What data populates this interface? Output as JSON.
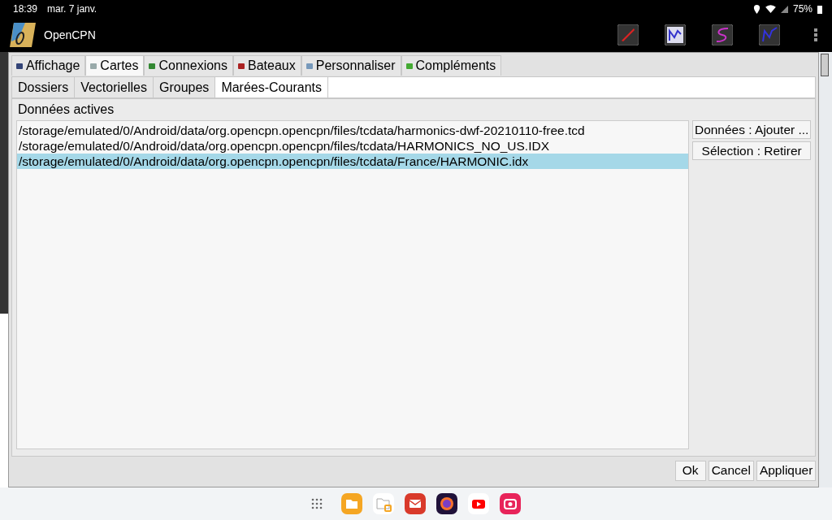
{
  "status_bar": {
    "time": "18:39",
    "date": "mar. 7 janv.",
    "battery": "75%"
  },
  "app_bar": {
    "title": "OpenCPN"
  },
  "tabs": [
    {
      "label": "Affichage",
      "selected": false,
      "color": "#334477"
    },
    {
      "label": "Cartes",
      "selected": true,
      "color": "#99aaaa"
    },
    {
      "label": "Connexions",
      "selected": false,
      "color": "#338833"
    },
    {
      "label": "Bateaux",
      "selected": false,
      "color": "#aa2222"
    },
    {
      "label": "Personnaliser",
      "selected": false,
      "color": "#7799bb"
    },
    {
      "label": "Compléments",
      "selected": false,
      "color": "#44aa33"
    }
  ],
  "subtabs": [
    {
      "label": "Dossiers",
      "selected": false
    },
    {
      "label": "Vectorielles",
      "selected": false
    },
    {
      "label": "Groupes",
      "selected": false
    },
    {
      "label": "Marées-Courants",
      "selected": true
    }
  ],
  "section_label": "Données actives",
  "files": [
    {
      "path": "/storage/emulated/0/Android/data/org.opencpn.opencpn/files/tcdata/harmonics-dwf-20210110-free.tcd",
      "selected": false
    },
    {
      "path": "/storage/emulated/0/Android/data/org.opencpn.opencpn/files/tcdata/HARMONICS_NO_US.IDX",
      "selected": false
    },
    {
      "path": "/storage/emulated/0/Android/data/org.opencpn.opencpn/files/tcdata/France/HARMONIC.idx",
      "selected": true
    }
  ],
  "side_buttons": [
    "Données : Ajouter ...",
    "Sélection : Retirer"
  ],
  "dialog_buttons": [
    "Ok",
    "Cancel",
    "Appliquer"
  ]
}
